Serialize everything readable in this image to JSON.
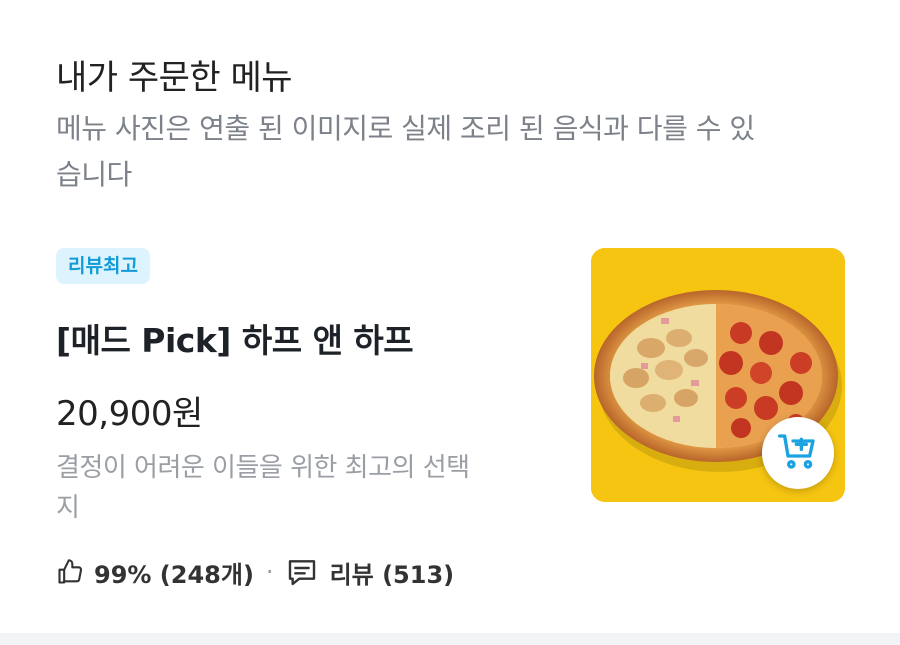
{
  "section": {
    "title": "내가 주문한 메뉴",
    "description": "메뉴 사진은 연출 된 이미지로 실제 조리 된 음식과 다를 수 있습니다"
  },
  "menu": {
    "badge": "리뷰최고",
    "name": "[매드 Pick] 하프 앤 하프",
    "price": "20,900원",
    "description": "결정이 어려운 이들을 위한 최고의 선택지",
    "likes": "99% (248개)",
    "separator": "·",
    "reviews": "리뷰 (513)",
    "image_alt": "pizza-image"
  },
  "icons": {
    "like": "thumbs-up-icon",
    "review": "review-bubble-icon",
    "cart": "add-to-cart-icon"
  },
  "colors": {
    "badge_bg": "#ddf3fd",
    "badge_text": "#129bd9",
    "cart_icon": "#1aa3e0",
    "image_bg": "#f6c512"
  }
}
